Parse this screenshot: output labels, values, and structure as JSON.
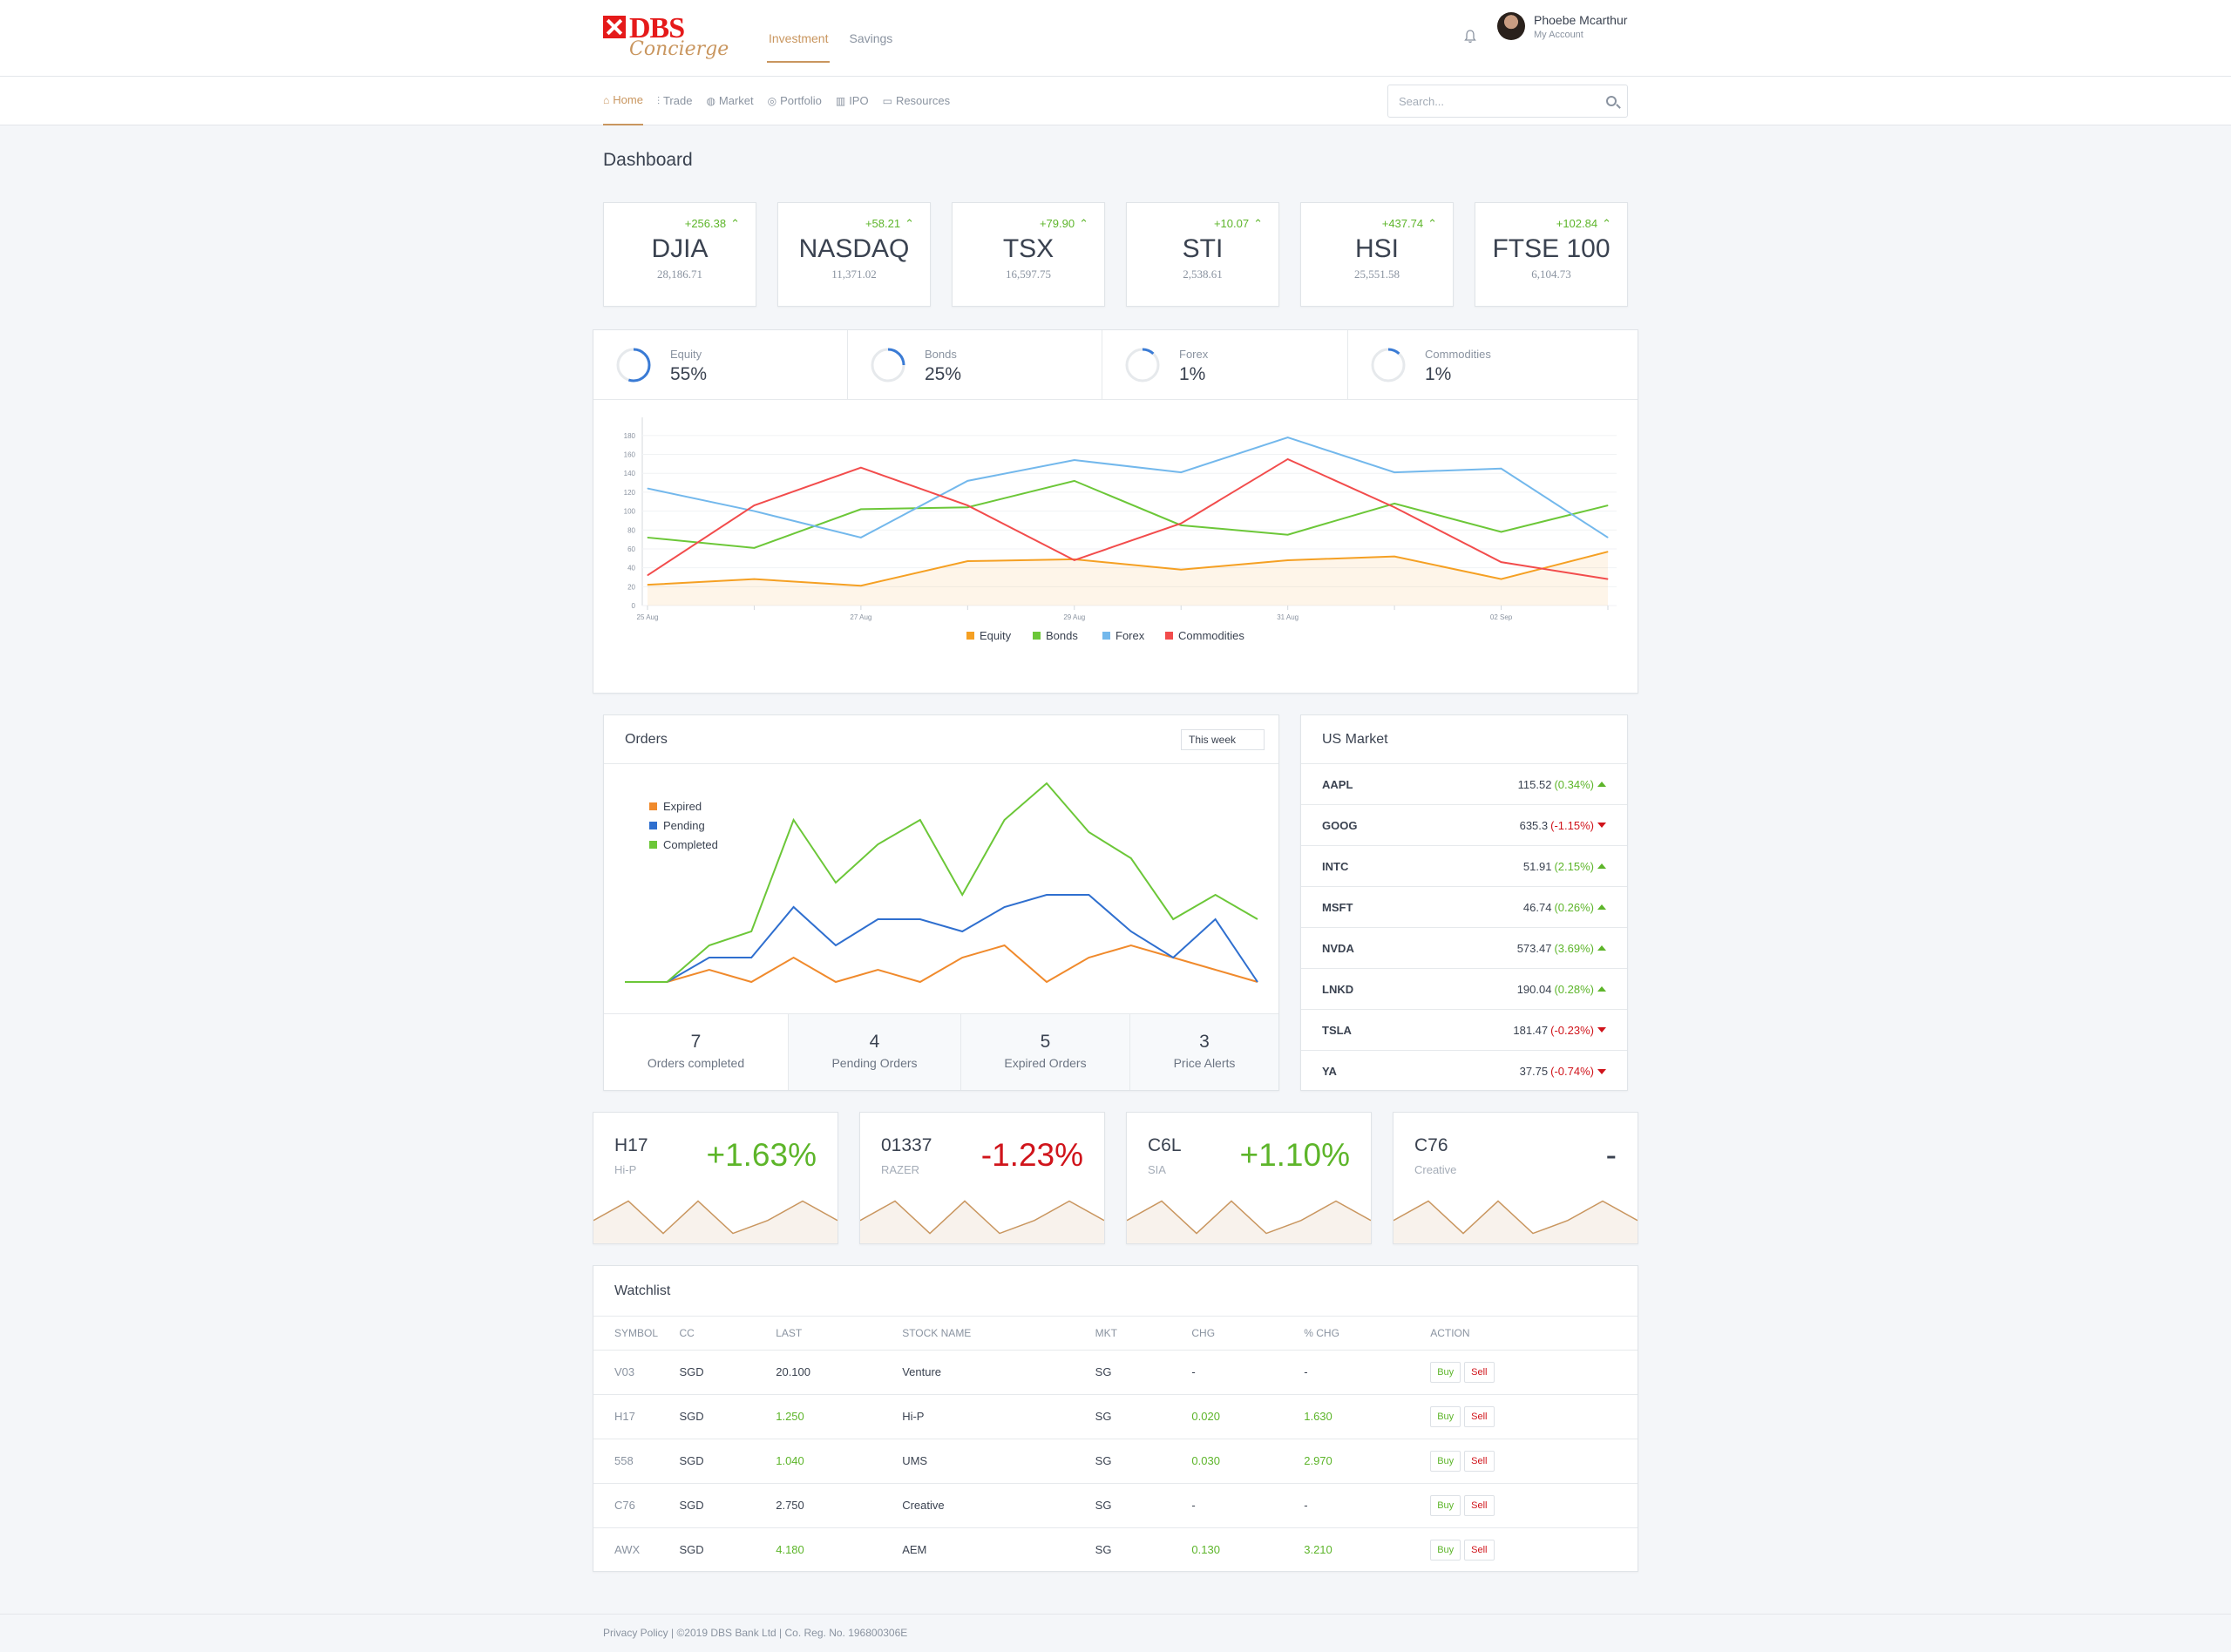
{
  "brand": {
    "name": "DBS",
    "sub": "Concierge",
    "color": "#e51a1a",
    "accent": "#c9965f"
  },
  "header": {
    "tabs": [
      {
        "label": "Investment",
        "active": true
      },
      {
        "label": "Savings",
        "active": false
      }
    ],
    "user": {
      "name": "Phoebe Mcarthur",
      "account": "My Account"
    },
    "icons": {
      "bell": "bell-icon"
    }
  },
  "subnav": {
    "items": [
      {
        "label": "Home",
        "icon": "home-icon",
        "glyph": "⌂",
        "active": true
      },
      {
        "label": "Trade",
        "icon": "bar-chart-icon",
        "glyph": "⫶",
        "active": false
      },
      {
        "label": "Market",
        "icon": "globe-icon",
        "glyph": "◍",
        "active": false
      },
      {
        "label": "Portfolio",
        "icon": "compass-icon",
        "glyph": "◎",
        "active": false
      },
      {
        "label": "IPO",
        "icon": "building-icon",
        "glyph": "▥",
        "active": false
      },
      {
        "label": "Resources",
        "icon": "folder-icon",
        "glyph": "▭",
        "active": false
      }
    ],
    "search": {
      "placeholder": "Search..."
    }
  },
  "page": {
    "title": "Dashboard"
  },
  "indices": [
    {
      "name": "DJIA",
      "change": "+256.38",
      "value": "28,186.71"
    },
    {
      "name": "NASDAQ",
      "change": "+58.21",
      "value": "11,371.02"
    },
    {
      "name": "TSX",
      "change": "+79.90",
      "value": "16,597.75"
    },
    {
      "name": "STI",
      "change": "+10.07",
      "value": "2,538.61"
    },
    {
      "name": "HSI",
      "change": "+437.74",
      "value": "25,551.58"
    },
    {
      "name": "FTSE 100",
      "change": "+102.84",
      "value": "6,104.73"
    }
  ],
  "allocation": [
    {
      "label": "Equity",
      "percent": "55%",
      "fraction": 0.55
    },
    {
      "label": "Bonds",
      "percent": "25%",
      "fraction": 0.25
    },
    {
      "label": "Forex",
      "percent": "1%",
      "fraction": 0.01
    },
    {
      "label": "Commodities",
      "percent": "1%",
      "fraction": 0.01
    }
  ],
  "chart_data": [
    {
      "type": "line",
      "x": [
        "25 Aug",
        "26 Aug",
        "27 Aug",
        "28 Aug",
        "29 Aug",
        "30 Aug",
        "31 Aug",
        "01 Sep",
        "02 Sep",
        "03 Sep"
      ],
      "x_tick_labels": [
        "25 Aug",
        "27 Aug",
        "29 Aug",
        "31 Aug",
        "02 Sep"
      ],
      "y_ticks": [
        0,
        20,
        40,
        60,
        80,
        100,
        120,
        140,
        160,
        180
      ],
      "ylim": [
        0,
        190
      ],
      "legend": "bottom",
      "series": [
        {
          "name": "Equity",
          "color": "#f5a023",
          "area": true,
          "values": [
            22,
            28,
            21,
            47,
            49,
            38,
            48,
            52,
            28,
            57
          ]
        },
        {
          "name": "Bonds",
          "color": "#6cc738",
          "values": [
            72,
            61,
            102,
            104,
            132,
            85,
            75,
            108,
            78,
            106
          ]
        },
        {
          "name": "Forex",
          "color": "#73b8ec",
          "values": [
            124,
            100,
            72,
            132,
            154,
            141,
            178,
            141,
            145,
            72
          ]
        },
        {
          "name": "Commodities",
          "color": "#f24c4c",
          "values": [
            32,
            106,
            146,
            106,
            48,
            87,
            155,
            104,
            46,
            28
          ]
        }
      ]
    },
    {
      "type": "line",
      "x": [
        1,
        2,
        3,
        4,
        5,
        6,
        7,
        8,
        9,
        10,
        11,
        12,
        13,
        14,
        15,
        16
      ],
      "ylim": [
        0,
        100
      ],
      "legend": "top-left",
      "series": [
        {
          "name": "Expired",
          "color": "#f08a2c",
          "values": [
            0,
            0,
            7,
            0,
            14,
            0,
            7,
            0,
            14,
            21,
            0,
            14,
            21,
            14,
            7,
            0
          ]
        },
        {
          "name": "Pending",
          "color": "#2f6fcf",
          "values": [
            0,
            0,
            14,
            14,
            43,
            21,
            36,
            36,
            29,
            43,
            50,
            50,
            29,
            14,
            36,
            0
          ]
        },
        {
          "name": "Completed",
          "color": "#6cc738",
          "values": [
            0,
            0,
            21,
            29,
            93,
            57,
            79,
            93,
            50,
            93,
            114,
            86,
            71,
            36,
            50,
            36
          ]
        }
      ]
    },
    {
      "type": "area",
      "x": [
        1,
        2,
        3,
        4,
        5,
        6,
        7,
        8
      ],
      "values": [
        3,
        6,
        1,
        6,
        1,
        3,
        6,
        3
      ],
      "color": "#c9965f"
    }
  ],
  "orders": {
    "title": "Orders",
    "period": "This week",
    "stats": [
      {
        "n": "7",
        "label": "Orders completed"
      },
      {
        "n": "4",
        "label": "Pending Orders"
      },
      {
        "n": "5",
        "label": "Expired Orders"
      },
      {
        "n": "3",
        "label": "Price Alerts"
      }
    ]
  },
  "us_market": {
    "title": "US Market",
    "rows": [
      {
        "sym": "AAPL",
        "price": "115.52",
        "chg": "(0.34%)",
        "dir": "up"
      },
      {
        "sym": "GOOG",
        "price": "635.3",
        "chg": "(-1.15%)",
        "dir": "down"
      },
      {
        "sym": "INTC",
        "price": "51.91",
        "chg": "(2.15%)",
        "dir": "up"
      },
      {
        "sym": "MSFT",
        "price": "46.74",
        "chg": "(0.26%)",
        "dir": "up"
      },
      {
        "sym": "NVDA",
        "price": "573.47",
        "chg": "(3.69%)",
        "dir": "up"
      },
      {
        "sym": "LNKD",
        "price": "190.04",
        "chg": "(0.28%)",
        "dir": "up"
      },
      {
        "sym": "TSLA",
        "price": "181.47",
        "chg": "(-0.23%)",
        "dir": "down"
      },
      {
        "sym": "YA",
        "price": "37.75",
        "chg": "(-0.74%)",
        "dir": "down"
      }
    ]
  },
  "stocks": [
    {
      "sym": "H17",
      "name": "Hi-P",
      "pct": "+1.63%",
      "color": "#5db52a"
    },
    {
      "sym": "01337",
      "name": "RAZER",
      "pct": "-1.23%",
      "color": "#d0141b"
    },
    {
      "sym": "C6L",
      "name": "SIA",
      "pct": "+1.10%",
      "color": "#5db52a"
    },
    {
      "sym": "C76",
      "name": "Creative",
      "pct": "-",
      "color": "#3a4250"
    }
  ],
  "watchlist": {
    "title": "Watchlist",
    "columns": [
      "SYMBOL",
      "CC",
      "LAST",
      "STOCK NAME",
      "MKT",
      "CHG",
      "% CHG",
      "ACTION"
    ],
    "buy_label": "Buy",
    "sell_label": "Sell",
    "rows": [
      {
        "sym": "V03",
        "cc": "SGD",
        "last": "20.100",
        "name": "Venture",
        "mkt": "SG",
        "chg": "-",
        "pchg": "-",
        "up": false
      },
      {
        "sym": "H17",
        "cc": "SGD",
        "last": "1.250",
        "name": "Hi-P",
        "mkt": "SG",
        "chg": "0.020",
        "pchg": "1.630",
        "up": true
      },
      {
        "sym": "558",
        "cc": "SGD",
        "last": "1.040",
        "name": "UMS",
        "mkt": "SG",
        "chg": "0.030",
        "pchg": "2.970",
        "up": true
      },
      {
        "sym": "C76",
        "cc": "SGD",
        "last": "2.750",
        "name": "Creative",
        "mkt": "SG",
        "chg": "-",
        "pchg": "-",
        "up": false
      },
      {
        "sym": "AWX",
        "cc": "SGD",
        "last": "4.180",
        "name": "AEM",
        "mkt": "SG",
        "chg": "0.130",
        "pchg": "3.210",
        "up": true
      }
    ]
  },
  "footer": {
    "text": "Privacy Policy | ©2019 DBS Bank Ltd | Co. Reg. No. 196800306E"
  }
}
